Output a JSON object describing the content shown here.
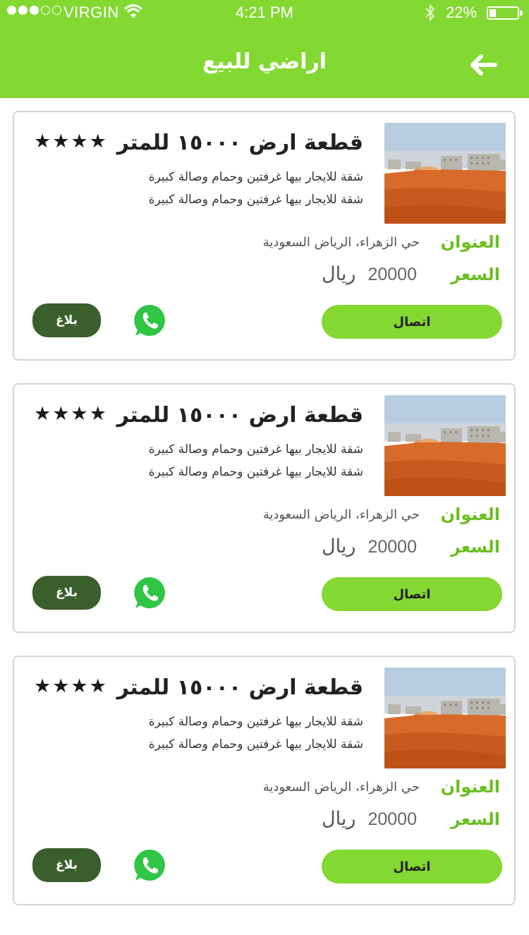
{
  "status_bar": {
    "carrier": "VIRGIN",
    "time": "4:21 PM",
    "battery": "22%",
    "signal_full_dots": 3,
    "signal_total_dots": 5
  },
  "header": {
    "title": "اراضي للبيع",
    "back_icon": "arrow-left-icon",
    "background": "#83d832"
  },
  "listings": [
    {
      "title": "قطعة ارض ١٥٠٠٠ للمتر",
      "rating": 4,
      "stars": "★★★★",
      "description_lines": [
        "شقة  للايجار بيها غرفتين وحمام وصالة كبيرة",
        "شقة  للايجار بيها غرفتين وحمام وصالة كبيرة"
      ],
      "address_label": "العنوان",
      "address": "حي الزهراء، الرياض السعودية",
      "price_label": "السعر",
      "price": "20000",
      "currency": "ريال",
      "contact_label": "اتصال",
      "report_label": "بلاغ"
    },
    {
      "title": "قطعة ارض ١٥٠٠٠ للمتر",
      "rating": 4,
      "stars": "★★★★",
      "description_lines": [
        "شقة  للايجار بيها غرفتين وحمام وصالة كبيرة",
        "شقة  للايجار بيها غرفتين وحمام وصالة كبيرة"
      ],
      "address_label": "العنوان",
      "address": "حي الزهراء، الرياض السعودية",
      "price_label": "السعر",
      "price": "20000",
      "currency": "ريال",
      "contact_label": "اتصال",
      "report_label": "بلاغ"
    },
    {
      "title": "قطعة ارض ١٥٠٠٠ للمتر",
      "rating": 4,
      "stars": "★★★★",
      "description_lines": [
        "شقة  للايجار بيها غرفتين وحمام وصالة كبيرة",
        "شقة  للايجار بيها غرفتين وحمام وصالة كبيرة"
      ],
      "address_label": "العنوان",
      "address": "حي الزهراء، الرياض السعودية",
      "price_label": "السعر",
      "price": "20000",
      "currency": "ريال",
      "contact_label": "اتصال",
      "report_label": "بلاغ"
    }
  ],
  "colors": {
    "accent": "#83d832",
    "label_green": "#6bbf22",
    "report_button": "#3a5f2c",
    "whatsapp": "#25d366"
  }
}
